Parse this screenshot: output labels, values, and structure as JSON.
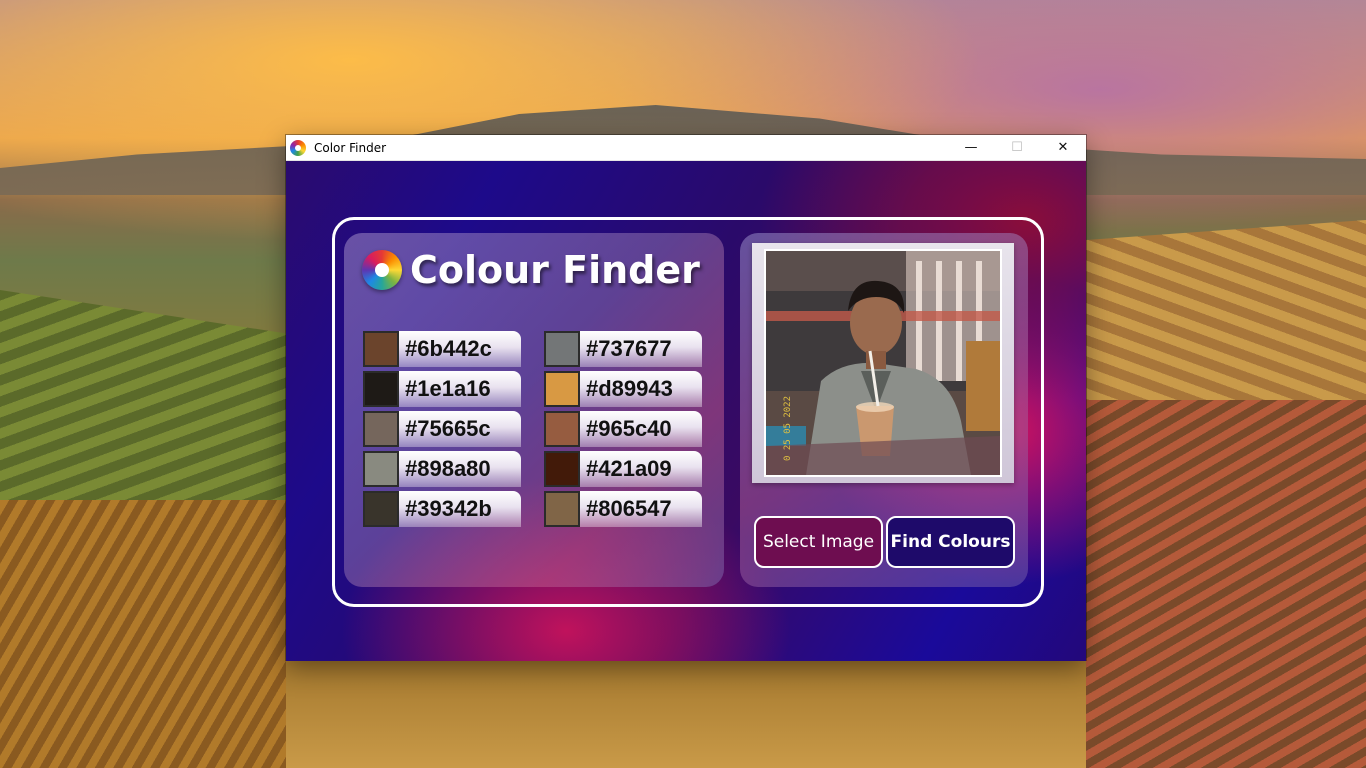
{
  "window": {
    "title": "Color Finder",
    "controls": {
      "minimize": "—",
      "maximize": "☐",
      "close": "✕"
    }
  },
  "app": {
    "heading": "Colour Finder",
    "icons": {
      "app": "color-wheel-icon",
      "heading": "color-wheel-icon"
    },
    "colours_left": [
      {
        "hex": "#6b442c",
        "swatch": "#6b442c"
      },
      {
        "hex": "#1e1a16",
        "swatch": "#1e1a16"
      },
      {
        "hex": "#75665c",
        "swatch": "#75665c"
      },
      {
        "hex": "#898a80",
        "swatch": "#898a80"
      },
      {
        "hex": "#39342b",
        "swatch": "#39342b"
      }
    ],
    "colours_right": [
      {
        "hex": "#737677",
        "swatch": "#737677"
      },
      {
        "hex": "#d89943",
        "swatch": "#d89943"
      },
      {
        "hex": "#965c40",
        "swatch": "#965c40"
      },
      {
        "hex": "#421a09",
        "swatch": "#421a09"
      },
      {
        "hex": "#806547",
        "swatch": "#806547"
      }
    ],
    "buttons": {
      "select": "Select Image",
      "find": "Find Colours"
    }
  }
}
